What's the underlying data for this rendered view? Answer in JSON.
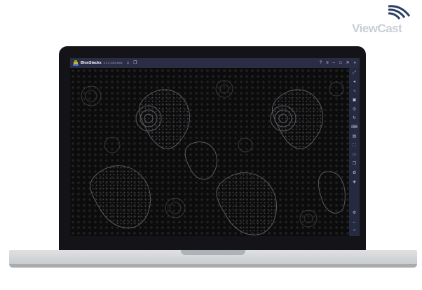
{
  "logo": {
    "text": "ViewCast"
  },
  "window": {
    "app_name": "BlueStacks",
    "version": "5.9.0.1026 Beta",
    "icons": {
      "home": "home-icon",
      "multi_instance": "multi-instance-icon",
      "help": "help-icon",
      "menu": "menu-icon",
      "minimize": "minimize-icon",
      "maximize": "maximize-icon",
      "close": "close-icon",
      "collapse": "collapse-sidebar-icon"
    }
  },
  "sidebar": {
    "items": [
      "fullscreen-icon",
      "volume-up-icon",
      "volume-down-icon",
      "media-icon",
      "screen-record-icon",
      "rotate-icon",
      "macro-icon",
      "apk-install-icon",
      "screenshot-icon",
      "folder-icon",
      "multi-instance-icon",
      "eco-mode-icon",
      "layers-icon",
      "settings-icon",
      "back-icon",
      "home-icon",
      "recent-apps-icon"
    ]
  }
}
